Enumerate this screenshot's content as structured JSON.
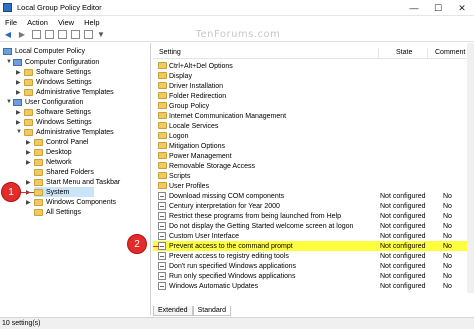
{
  "window": {
    "title": "Local Group Policy Editor",
    "controls": [
      "—",
      "☐",
      "✕"
    ]
  },
  "menu": [
    "File",
    "Action",
    "View",
    "Help"
  ],
  "toolbar_icons": [
    "back-arrow-icon",
    "forward-arrow-icon",
    "up-folder-icon",
    "show-hide-tree-icon",
    "export-list-icon",
    "help-icon",
    "properties-icon",
    "filter-icon"
  ],
  "watermark": "TenForums.com",
  "tree": [
    {
      "label": "Local Computer Policy",
      "icon": "computer-policy-icon"
    },
    {
      "label": "Computer Configuration",
      "icon": "computer-icon"
    },
    {
      "label": "Software Settings",
      "icon": "folder-icon"
    },
    {
      "label": "Windows Settings",
      "icon": "folder-icon"
    },
    {
      "label": "Administrative Templates",
      "icon": "folder-icon"
    },
    {
      "label": "User Configuration",
      "icon": "computer-icon"
    },
    {
      "label": "Software Settings",
      "icon": "folder-icon"
    },
    {
      "label": "Windows Settings",
      "icon": "folder-icon"
    },
    {
      "label": "Administrative Templates",
      "icon": "folder-icon"
    },
    {
      "label": "Control Panel",
      "icon": "folder-icon"
    },
    {
      "label": "Desktop",
      "icon": "folder-icon"
    },
    {
      "label": "Network",
      "icon": "folder-icon"
    },
    {
      "label": "Shared Folders",
      "icon": "folder-icon"
    },
    {
      "label": "Start Menu and Taskbar",
      "icon": "folder-icon"
    },
    {
      "label": "System",
      "icon": "folder-icon",
      "selected": true
    },
    {
      "label": "Windows Components",
      "icon": "folder-icon"
    },
    {
      "label": "All Settings",
      "icon": "folder-icon"
    }
  ],
  "list": {
    "headers": {
      "setting": "Setting",
      "state": "State",
      "comment": "Comment"
    },
    "rows": [
      {
        "name": "Ctrl+Alt+Del Options",
        "type": "folder"
      },
      {
        "name": "Display",
        "type": "folder"
      },
      {
        "name": "Driver Installation",
        "type": "folder"
      },
      {
        "name": "Folder Redirection",
        "type": "folder"
      },
      {
        "name": "Group Policy",
        "type": "folder"
      },
      {
        "name": "Internet Communication Management",
        "type": "folder"
      },
      {
        "name": "Locale Services",
        "type": "folder"
      },
      {
        "name": "Logon",
        "type": "folder"
      },
      {
        "name": "Mitigation Options",
        "type": "folder"
      },
      {
        "name": "Power Management",
        "type": "folder"
      },
      {
        "name": "Removable Storage Access",
        "type": "folder"
      },
      {
        "name": "Scripts",
        "type": "folder"
      },
      {
        "name": "User Profiles",
        "type": "folder"
      },
      {
        "name": "Download missing COM components",
        "type": "setting",
        "state": "Not configured",
        "comment": "No"
      },
      {
        "name": "Century interpretation for Year 2000",
        "type": "setting",
        "state": "Not configured",
        "comment": "No"
      },
      {
        "name": "Restrict these programs from being launched from Help",
        "type": "setting",
        "state": "Not configured",
        "comment": "No"
      },
      {
        "name": "Do not display the Getting Started welcome screen at logon",
        "type": "setting",
        "state": "Not configured",
        "comment": "No"
      },
      {
        "name": "Custom User Interface",
        "type": "setting",
        "state": "Not configured",
        "comment": "No"
      },
      {
        "name": "Prevent access to the command prompt",
        "type": "setting",
        "state": "Not configured",
        "comment": "No",
        "highlighted": true
      },
      {
        "name": "Prevent access to registry editing tools",
        "type": "setting",
        "state": "Not configured",
        "comment": "No"
      },
      {
        "name": "Don't run specified Windows applications",
        "type": "setting",
        "state": "Not configured",
        "comment": "No"
      },
      {
        "name": "Run only specified Windows applications",
        "type": "setting",
        "state": "Not configured",
        "comment": "No"
      },
      {
        "name": "Windows Automatic Updates",
        "type": "setting",
        "state": "Not configured",
        "comment": "No"
      }
    ]
  },
  "tabs": [
    "Extended",
    "Standard"
  ],
  "active_tab": "Standard",
  "annotations": [
    "1",
    "2"
  ],
  "status": "10 setting(s)",
  "colors": {
    "highlight": "#ffff40",
    "annotation": "#e22b2b",
    "selection": "#cce4f7"
  }
}
